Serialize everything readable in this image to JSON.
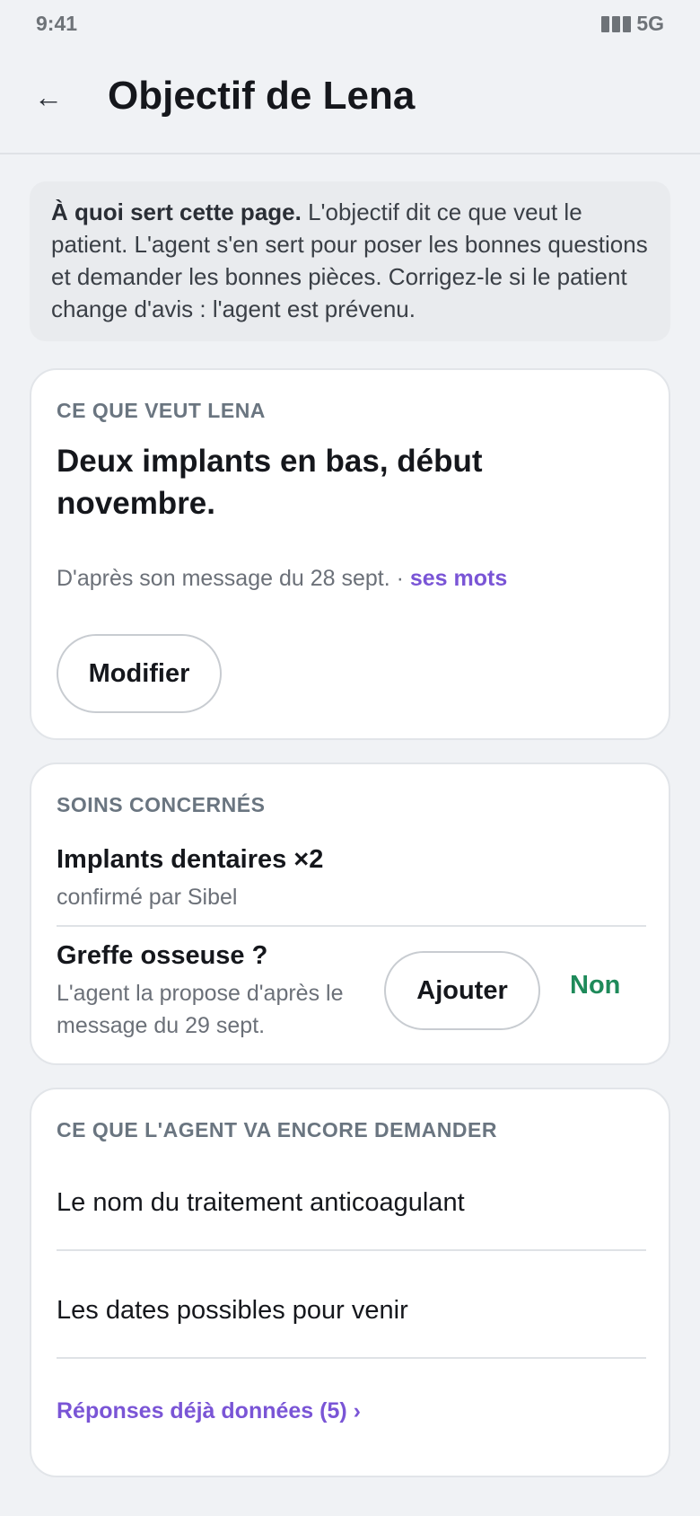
{
  "status_bar": {
    "time": "9:41",
    "network": "5G",
    "icon": "signal-bars-icon"
  },
  "header": {
    "back_icon": "←",
    "title": "Objectif de Lena"
  },
  "info": {
    "lead": "À quoi sert cette page.",
    "text": " L'objectif dit ce que veut le patient. L'agent s'en sert pour poser les bonnes questions et demander les bonnes pièces. Corrigez-le si le patient change d'avis : l'agent est prévenu."
  },
  "goal_card": {
    "label": "CE QUE VEUT LENA",
    "goal": "Deux implants en bas, début novembre.",
    "source": "D'après son message du 28 sept. · ",
    "source_link": "ses mots",
    "modify_label": "Modifier"
  },
  "care_card": {
    "label": "SOINS CONCERNÉS",
    "items": [
      {
        "title": "Implants dentaires ×2",
        "subtitle": "confirmé par Sibel"
      },
      {
        "title": "Greffe osseuse ?",
        "subtitle": "L'agent la propose d'après le message du 29 sept.",
        "add_label": "Ajouter",
        "no_label": "Non"
      }
    ]
  },
  "ask_card": {
    "label": "CE QUE L'AGENT VA ENCORE DEMANDER",
    "items": [
      "Le nom du traitement anticoagulant",
      "Les dates possibles pour venir"
    ],
    "answers_link": "Réponses déjà données (5) ›"
  },
  "colors": {
    "accent": "#7a55d6",
    "positive": "#1e8a5a",
    "background": "#f0f2f5"
  }
}
